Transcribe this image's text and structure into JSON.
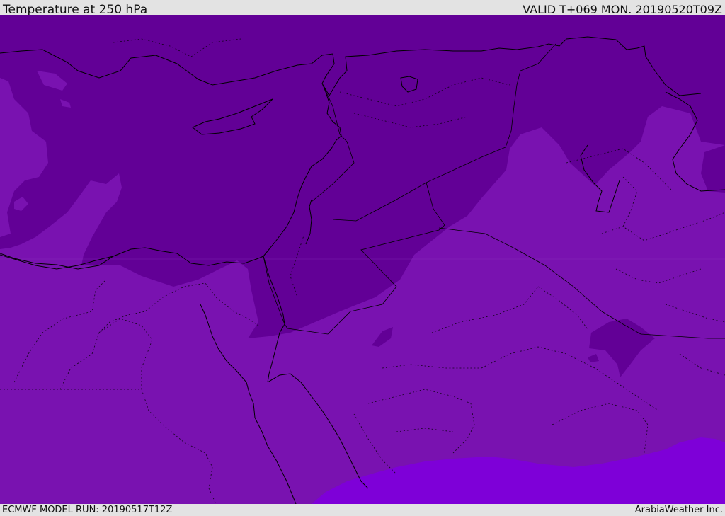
{
  "header": {
    "title": "Temperature at 250 hPa",
    "valid": "VALID T+069 MON. 20190520T09Z"
  },
  "footer": {
    "model_run": "ECMWF MODEL RUN: 20190517T12Z",
    "credit": "ArabiaWeather Inc."
  },
  "map": {
    "variable": "temperature",
    "level": "250 hPa",
    "colors": {
      "cold": "#620096",
      "mid": "#7912b0",
      "warm": "#7e00d8",
      "borders": "#000000"
    }
  }
}
